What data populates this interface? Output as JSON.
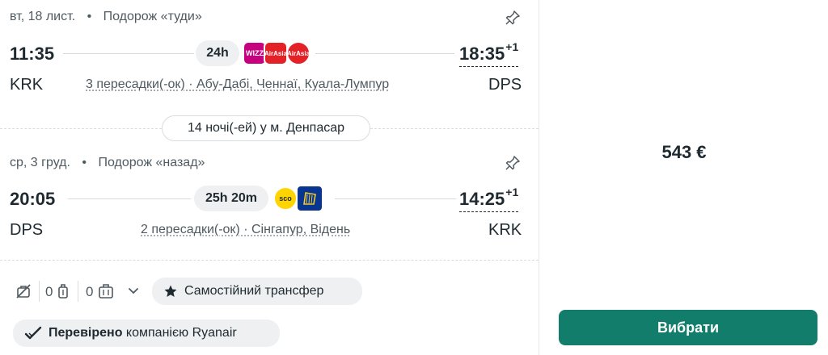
{
  "outbound": {
    "header_date": "вт, 18 лист.",
    "header_label": "Подорож «туди»",
    "dep_time": "11:35",
    "arr_time": "18:35",
    "arr_plus": "+1",
    "duration": "24h",
    "dep_code": "KRK",
    "arr_code": "DPS",
    "stops": "3 пересадки(-ок) · Абу-Дабі, Ченнаї, Куала-Лумпур",
    "airlines": [
      {
        "name": "Wizz Air",
        "text": "WIZZ",
        "color": "#c6007e"
      },
      {
        "name": "AirAsia",
        "text": "AirAsia",
        "color": "#e42126"
      },
      {
        "name": "AirAsia",
        "text": "AirAsia",
        "color": "#e42126"
      }
    ]
  },
  "stay": "14 ночі(-ей) у м. Денпасар",
  "inbound": {
    "header_date": "ср, 3 груд.",
    "header_label": "Подорож «назад»",
    "dep_time": "20:05",
    "arr_time": "14:25",
    "arr_plus": "+1",
    "duration": "25h 20m",
    "dep_code": "DPS",
    "arr_code": "KRK",
    "stops": "2 пересадки(-ок) · Сінгапур, Відень",
    "airlines": [
      {
        "name": "Scoot",
        "text": "sco",
        "color": "#ffd400"
      },
      {
        "name": "Ryanair",
        "text": "",
        "color": "#073590"
      }
    ]
  },
  "bags": {
    "cabin_count": "0",
    "checked_count": "0"
  },
  "transfer_label": "Самостійний трансфер",
  "verified": {
    "bold": "Перевірено",
    "rest": "компанією Ryanair"
  },
  "price": "543 €",
  "select_button": "Вибрати",
  "colors": {
    "accent": "#127d6a",
    "text": "#1f2a30",
    "muted": "#4f5a61",
    "chip_bg": "#eef0f2"
  }
}
